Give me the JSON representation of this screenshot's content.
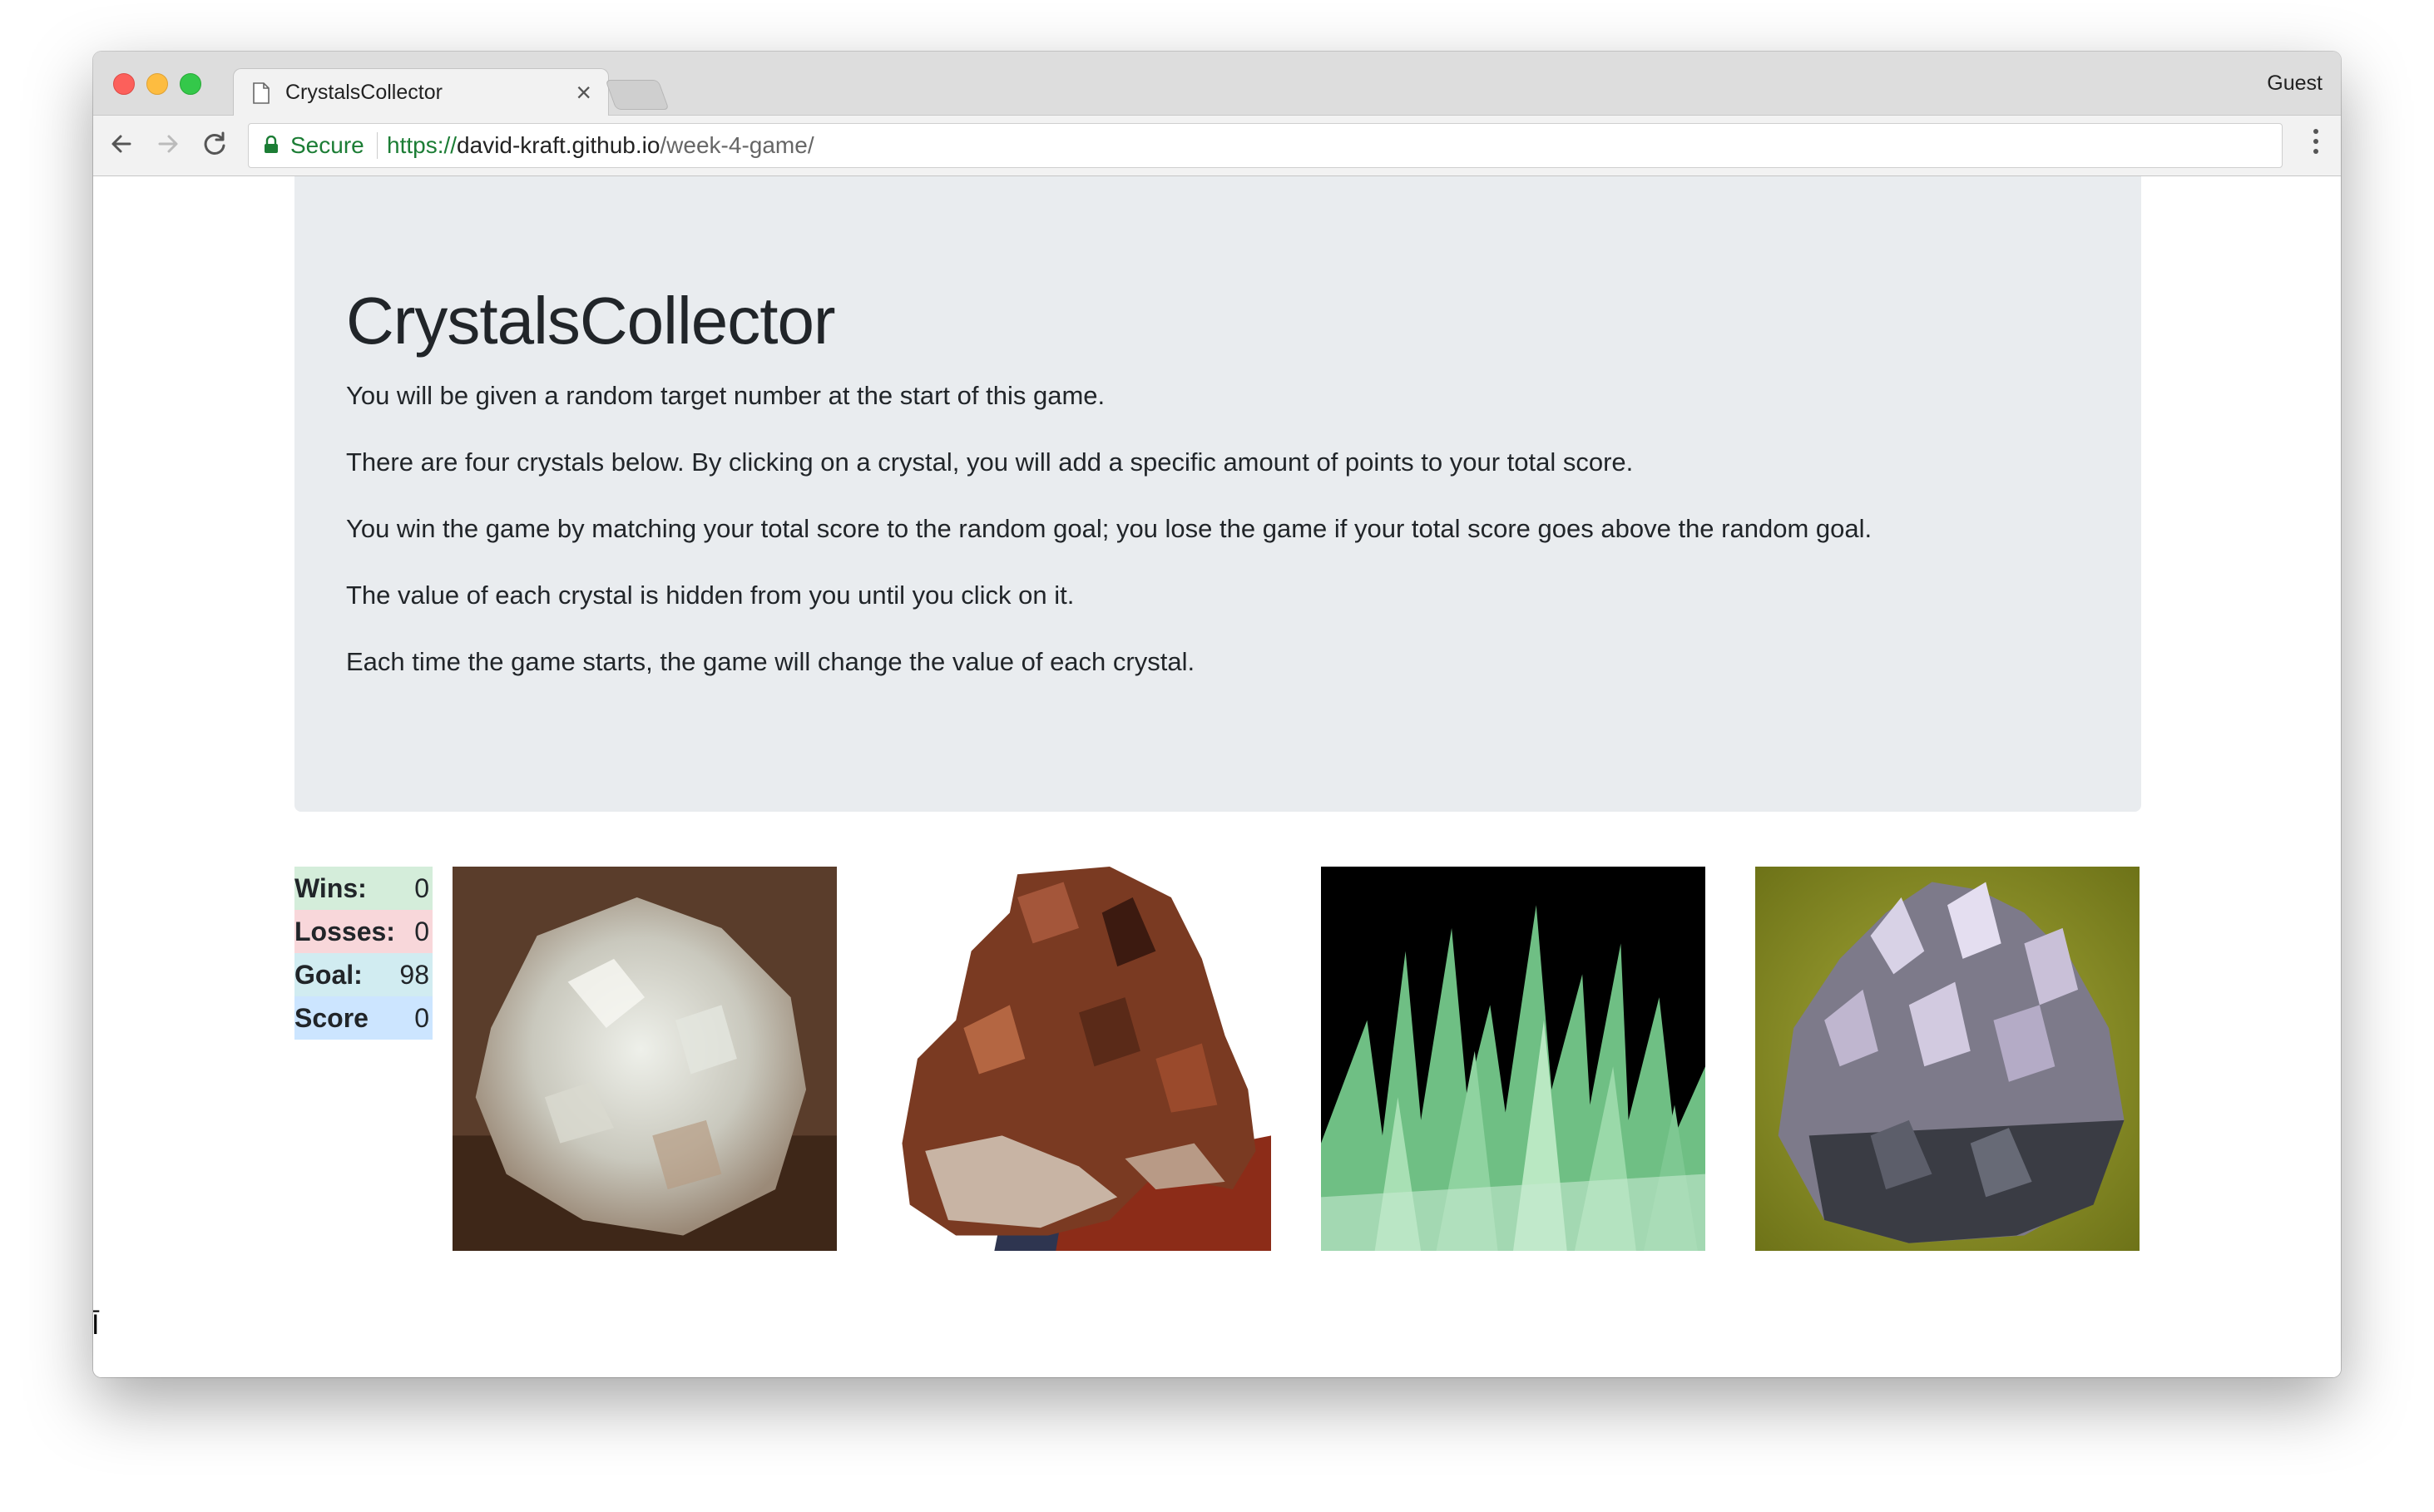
{
  "browser": {
    "tab_title": "CrystalsCollector",
    "tab_close": "×",
    "profile": "Guest",
    "secure_label": "Secure",
    "url_scheme": "https://",
    "url_host": "david-kraft.github.io",
    "url_path": "/week-4-game/"
  },
  "page": {
    "title": "CrystalsCollector",
    "paragraphs": [
      "You will be given a random target number at the start of this game.",
      "There are four crystals below. By clicking on a crystal, you will add a specific amount of points to your total score.",
      "You win the game by matching your total score to the random goal; you lose the game if your total score goes above the random goal.",
      "The value of each crystal is hidden from you until you click on it.",
      "Each time the game starts, the game will change the value of each crystal."
    ]
  },
  "stats": {
    "wins_label": "Wins:",
    "wins": "0",
    "losses_label": "Losses:",
    "losses": "0",
    "goal_label": "Goal:",
    "goal": "98",
    "score_label": "Score",
    "score": "0"
  },
  "crystals": [
    {
      "name": "white quartz crystal"
    },
    {
      "name": "brown crystal cluster"
    },
    {
      "name": "green crystal spikes"
    },
    {
      "name": "amethyst crystal cluster"
    }
  ],
  "colors": {
    "jumbotron": "#e9ecef",
    "wins_bg": "#d4edda",
    "losses_bg": "#f8d7da",
    "goal_bg": "#d1ecf1",
    "score_bg": "#cce5ff",
    "secure_green": "#1c7d35"
  },
  "icons": {
    "back": "arrow-left-icon",
    "forward": "arrow-right-icon",
    "reload": "reload-icon",
    "lock": "lock-icon",
    "menu": "kebab-menu-icon",
    "tab": "document-icon"
  }
}
